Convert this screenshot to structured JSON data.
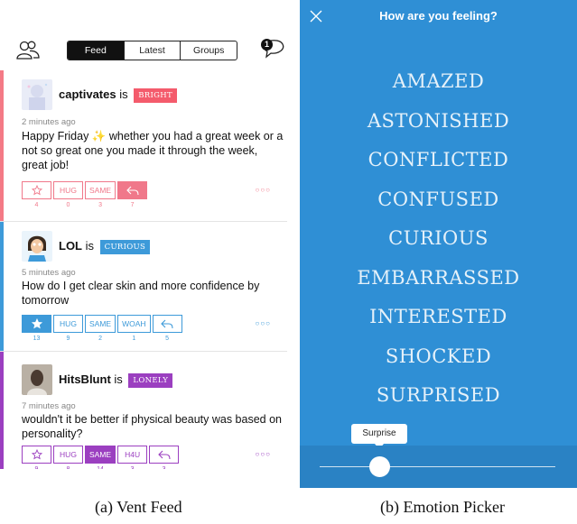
{
  "feed": {
    "tabs": [
      {
        "label": "Feed",
        "active": true
      },
      {
        "label": "Latest",
        "active": false
      },
      {
        "label": "Groups",
        "active": false
      }
    ],
    "notification_count": "1",
    "icons": {
      "left": "people-icon",
      "right": "chat-bubble-icon"
    },
    "posts": [
      {
        "username": "captivates",
        "connector": "is",
        "mood": "BRIGHT",
        "mood_color": "#f45b6c",
        "stripe_color": "#f47a86",
        "time": "2 minutes ago",
        "text": "Happy Friday ✨ whether you had a great week or a not so great one you made it through the week, great job!",
        "accent": "#f0788a",
        "actions": [
          {
            "type": "icon",
            "icon": "star-outline-icon",
            "count": "4",
            "active": false
          },
          {
            "type": "text",
            "label": "HUG",
            "count": "0",
            "active": false
          },
          {
            "type": "text",
            "label": "SAME",
            "count": "3",
            "active": false
          },
          {
            "type": "icon",
            "icon": "reply-icon",
            "count": "7",
            "active": true
          }
        ],
        "more": "○○○"
      },
      {
        "username": "LOL",
        "connector": "is",
        "mood": "CURIOUS",
        "mood_color": "#3d9ad9",
        "stripe_color": "#3d9ad9",
        "time": "5 minutes ago",
        "text": "How do I get clear skin and more confidence by tomorrow",
        "accent": "#3d9ad9",
        "actions": [
          {
            "type": "icon",
            "icon": "star-filled-icon",
            "count": "13",
            "active": true
          },
          {
            "type": "text",
            "label": "HUG",
            "count": "9",
            "active": false
          },
          {
            "type": "text",
            "label": "SAME",
            "count": "2",
            "active": false
          },
          {
            "type": "text",
            "label": "WOAH",
            "count": "1",
            "active": false
          },
          {
            "type": "icon",
            "icon": "reply-icon",
            "count": "5",
            "active": false
          }
        ],
        "more": "○○○"
      },
      {
        "username": "HitsBlunt",
        "connector": "is",
        "mood": "LONELY",
        "mood_color": "#9b3fc0",
        "stripe_color": "#9b3fc0",
        "time": "7 minutes ago",
        "text": "wouldn't it be better if physical beauty was based on personality?",
        "accent": "#9b3fc0",
        "actions": [
          {
            "type": "icon",
            "icon": "star-outline-icon",
            "count": "9",
            "active": false
          },
          {
            "type": "text",
            "label": "HUG",
            "count": "8",
            "active": false
          },
          {
            "type": "text",
            "label": "SAME",
            "count": "14",
            "active": true
          },
          {
            "type": "text",
            "label": "H4U",
            "count": "3",
            "active": false
          },
          {
            "type": "icon",
            "icon": "reply-icon",
            "count": "3",
            "active": false
          }
        ],
        "more": "○○○"
      }
    ]
  },
  "picker": {
    "title": "How are you feeling?",
    "close_icon": "close-icon",
    "background_color": "#2f8fd5",
    "emotions": [
      "AMAZED",
      "ASTONISHED",
      "CONFLICTED",
      "CONFUSED",
      "CURIOUS",
      "EMBARRASSED",
      "INTERESTED",
      "SHOCKED",
      "SURPRISED"
    ],
    "slider_tooltip": "Surprise"
  },
  "captions": {
    "left": "(a) Vent Feed",
    "right": "(b) Emotion Picker"
  }
}
